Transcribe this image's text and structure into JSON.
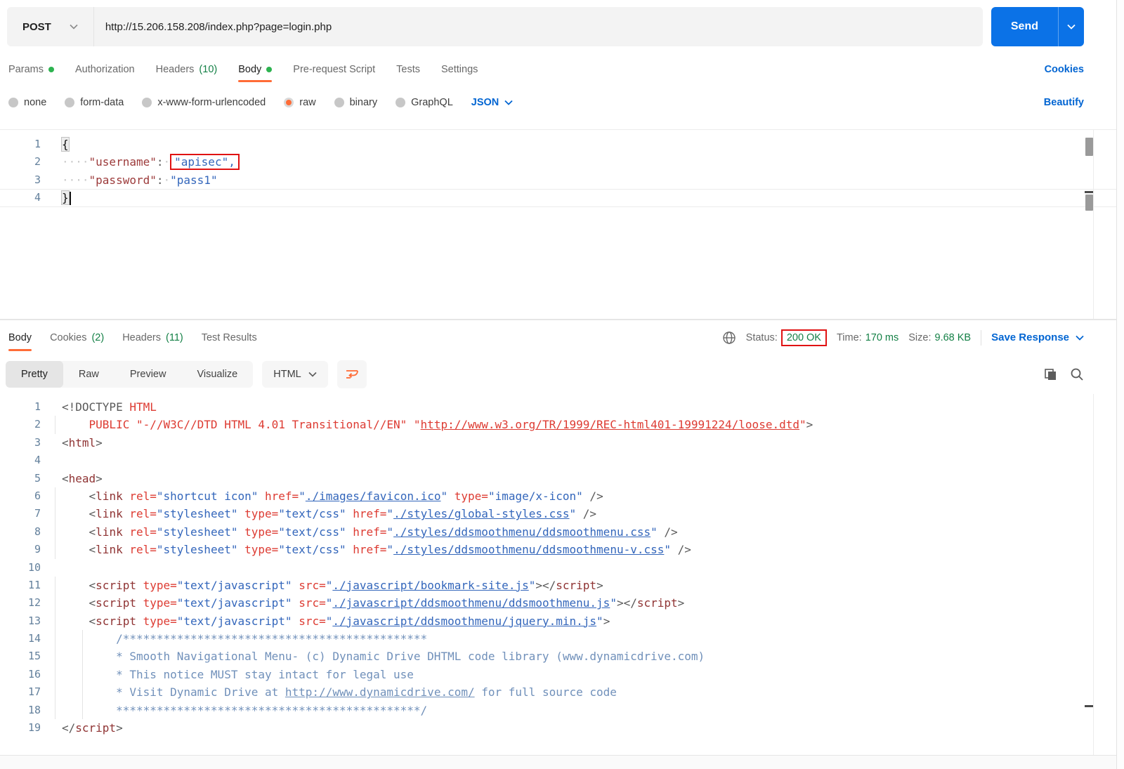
{
  "colors": {
    "accent_orange": "#ff6c37",
    "link_blue": "#0265d2",
    "send_blue": "#0b72e7",
    "text_green": "#148046",
    "dot_green": "#2db350",
    "annotation_red": "#e01212"
  },
  "request": {
    "method": "POST",
    "url": "http://15.206.158.208/index.php?page=login.php",
    "send_label": "Send",
    "cookies_link": "Cookies",
    "beautify_link": "Beautify",
    "content_type": "JSON",
    "tabs": [
      {
        "label": "Params",
        "dot": true
      },
      {
        "label": "Authorization"
      },
      {
        "label": "Headers",
        "count": "(10)"
      },
      {
        "label": "Body",
        "dot": true,
        "active": true
      },
      {
        "label": "Pre-request Script"
      },
      {
        "label": "Tests"
      },
      {
        "label": "Settings"
      }
    ],
    "body_modes": [
      {
        "label": "none"
      },
      {
        "label": "form-data"
      },
      {
        "label": "x-www-form-urlencoded"
      },
      {
        "label": "raw",
        "selected": true
      },
      {
        "label": "binary"
      },
      {
        "label": "GraphQL"
      }
    ],
    "editor_lines": [
      {
        "seg": [
          [
            "b",
            "{"
          ]
        ]
      },
      {
        "seg": [
          [
            "d",
            "····"
          ],
          [
            "k",
            "\"username\""
          ],
          [
            "p",
            ":"
          ],
          [
            "d",
            "·"
          ],
          [
            "v annot",
            "\"apisec\","
          ]
        ]
      },
      {
        "seg": [
          [
            "d",
            "····"
          ],
          [
            "k",
            "\"password\""
          ],
          [
            "p",
            ":"
          ],
          [
            "d",
            "·"
          ],
          [
            "v",
            "\"pass1\""
          ]
        ]
      },
      {
        "active": true,
        "seg": [
          [
            "b",
            "}"
          ],
          [
            "cursor",
            ""
          ]
        ]
      }
    ]
  },
  "response": {
    "tabs": [
      {
        "label": "Body",
        "active": true
      },
      {
        "label": "Cookies",
        "count": "(2)"
      },
      {
        "label": "Headers",
        "count": "(11)"
      },
      {
        "label": "Test Results"
      }
    ],
    "status_label": "Status:",
    "status_value": "200 OK",
    "time_label": "Time:",
    "time_value": "170 ms",
    "size_label": "Size:",
    "size_value": "9.68 KB",
    "save_response_label": "Save Response",
    "view_tabs": [
      {
        "label": "Pretty",
        "active": true
      },
      {
        "label": "Raw"
      },
      {
        "label": "Preview"
      },
      {
        "label": "Visualize"
      }
    ],
    "format": "HTML",
    "code_lines": [
      {
        "g": 0,
        "seg": [
          [
            "p",
            "<!DOCTYPE "
          ],
          [
            "r",
            "HTML"
          ]
        ]
      },
      {
        "g": 1,
        "seg": [
          [
            "w",
            "    "
          ],
          [
            "r",
            "PUBLIC \"-//W3C//DTD HTML 4.01 Transitional//EN\" \""
          ],
          [
            "ru",
            "http://www.w3.org/TR/1999/REC-html401-19991224/loose.dtd"
          ],
          [
            "r",
            "\""
          ],
          [
            "p",
            ">"
          ]
        ]
      },
      {
        "g": 0,
        "seg": [
          [
            "p",
            "<"
          ],
          [
            "t",
            "html"
          ],
          [
            "p",
            ">"
          ]
        ]
      },
      {
        "g": 0,
        "seg": []
      },
      {
        "g": 0,
        "seg": [
          [
            "p",
            "<"
          ],
          [
            "t",
            "head"
          ],
          [
            "p",
            ">"
          ]
        ]
      },
      {
        "g": 1,
        "seg": [
          [
            "w",
            "    "
          ],
          [
            "p",
            "<"
          ],
          [
            "t",
            "link"
          ],
          [
            "w",
            " "
          ],
          [
            "a",
            "rel="
          ],
          [
            "s",
            "\"shortcut icon\""
          ],
          [
            "w",
            " "
          ],
          [
            "a",
            "href="
          ],
          [
            "s",
            "\""
          ],
          [
            "u",
            "./images/favicon.ico"
          ],
          [
            "s",
            "\""
          ],
          [
            "w",
            " "
          ],
          [
            "a",
            "type="
          ],
          [
            "s",
            "\"image/x-icon\""
          ],
          [
            "p",
            " />"
          ]
        ]
      },
      {
        "g": 1,
        "seg": [
          [
            "w",
            "    "
          ],
          [
            "p",
            "<"
          ],
          [
            "t",
            "link"
          ],
          [
            "w",
            " "
          ],
          [
            "a",
            "rel="
          ],
          [
            "s",
            "\"stylesheet\""
          ],
          [
            "w",
            " "
          ],
          [
            "a",
            "type="
          ],
          [
            "s",
            "\"text/css\""
          ],
          [
            "w",
            " "
          ],
          [
            "a",
            "href="
          ],
          [
            "s",
            "\""
          ],
          [
            "u",
            "./styles/global-styles.css"
          ],
          [
            "s",
            "\""
          ],
          [
            "p",
            " />"
          ]
        ]
      },
      {
        "g": 1,
        "seg": [
          [
            "w",
            "    "
          ],
          [
            "p",
            "<"
          ],
          [
            "t",
            "link"
          ],
          [
            "w",
            " "
          ],
          [
            "a",
            "rel="
          ],
          [
            "s",
            "\"stylesheet\""
          ],
          [
            "w",
            " "
          ],
          [
            "a",
            "type="
          ],
          [
            "s",
            "\"text/css\""
          ],
          [
            "w",
            " "
          ],
          [
            "a",
            "href="
          ],
          [
            "s",
            "\""
          ],
          [
            "u",
            "./styles/ddsmoothmenu/ddsmoothmenu.css"
          ],
          [
            "s",
            "\""
          ],
          [
            "p",
            " />"
          ]
        ]
      },
      {
        "g": 1,
        "seg": [
          [
            "w",
            "    "
          ],
          [
            "p",
            "<"
          ],
          [
            "t",
            "link"
          ],
          [
            "w",
            " "
          ],
          [
            "a",
            "rel="
          ],
          [
            "s",
            "\"stylesheet\""
          ],
          [
            "w",
            " "
          ],
          [
            "a",
            "type="
          ],
          [
            "s",
            "\"text/css\""
          ],
          [
            "w",
            " "
          ],
          [
            "a",
            "href="
          ],
          [
            "s",
            "\""
          ],
          [
            "u",
            "./styles/ddsmoothmenu/ddsmoothmenu-v.css"
          ],
          [
            "s",
            "\""
          ],
          [
            "p",
            " />"
          ]
        ]
      },
      {
        "g": 0,
        "seg": []
      },
      {
        "g": 1,
        "seg": [
          [
            "w",
            "    "
          ],
          [
            "p",
            "<"
          ],
          [
            "t",
            "script"
          ],
          [
            "w",
            " "
          ],
          [
            "a",
            "type="
          ],
          [
            "s",
            "\"text/javascript\""
          ],
          [
            "w",
            " "
          ],
          [
            "a",
            "src="
          ],
          [
            "s",
            "\""
          ],
          [
            "u",
            "./javascript/bookmark-site.js"
          ],
          [
            "s",
            "\""
          ],
          [
            "p",
            "></"
          ],
          [
            "t",
            "script"
          ],
          [
            "p",
            ">"
          ]
        ]
      },
      {
        "g": 1,
        "seg": [
          [
            "w",
            "    "
          ],
          [
            "p",
            "<"
          ],
          [
            "t",
            "script"
          ],
          [
            "w",
            " "
          ],
          [
            "a",
            "type="
          ],
          [
            "s",
            "\"text/javascript\""
          ],
          [
            "w",
            " "
          ],
          [
            "a",
            "src="
          ],
          [
            "s",
            "\""
          ],
          [
            "u",
            "./javascript/ddsmoothmenu/ddsmoothmenu.js"
          ],
          [
            "s",
            "\""
          ],
          [
            "p",
            "></"
          ],
          [
            "t",
            "script"
          ],
          [
            "p",
            ">"
          ]
        ]
      },
      {
        "g": 1,
        "seg": [
          [
            "w",
            "    "
          ],
          [
            "p",
            "<"
          ],
          [
            "t",
            "script"
          ],
          [
            "w",
            " "
          ],
          [
            "a",
            "type="
          ],
          [
            "s",
            "\"text/javascript\""
          ],
          [
            "w",
            " "
          ],
          [
            "a",
            "src="
          ],
          [
            "s",
            "\""
          ],
          [
            "u",
            "./javascript/ddsmoothmenu/jquery.min.js"
          ],
          [
            "s",
            "\""
          ],
          [
            "p",
            ">"
          ]
        ]
      },
      {
        "g": 2,
        "seg": [
          [
            "w",
            "        "
          ],
          [
            "c",
            "/*********************************************"
          ]
        ]
      },
      {
        "g": 2,
        "seg": [
          [
            "w",
            "        "
          ],
          [
            "c",
            "* Smooth Navigational Menu- (c) Dynamic Drive DHTML code library (www.dynamicdrive.com)"
          ]
        ]
      },
      {
        "g": 2,
        "seg": [
          [
            "w",
            "        "
          ],
          [
            "c",
            "* This notice MUST stay intact for legal use"
          ]
        ]
      },
      {
        "g": 2,
        "seg": [
          [
            "w",
            "        "
          ],
          [
            "c",
            "* Visit Dynamic Drive at "
          ],
          [
            "cu",
            "http://www.dynamicdrive.com/"
          ],
          [
            "c",
            " for full source code"
          ]
        ]
      },
      {
        "g": 2,
        "seg": [
          [
            "w",
            "        "
          ],
          [
            "c",
            "*********************************************/"
          ]
        ]
      },
      {
        "g": 0,
        "seg": [
          [
            "p",
            "</"
          ],
          [
            "t",
            "script"
          ],
          [
            "p",
            ">"
          ]
        ]
      }
    ]
  },
  "icons": {
    "method_caret": "chevron-down-icon",
    "send_caret": "chevron-down-icon",
    "json_caret": "chevron-down-icon",
    "format_caret": "chevron-down-icon",
    "save_caret": "chevron-down-icon",
    "globe": "globe-icon",
    "wrap": "wrap-lines-icon",
    "copy": "copy-icon",
    "search": "search-icon"
  }
}
